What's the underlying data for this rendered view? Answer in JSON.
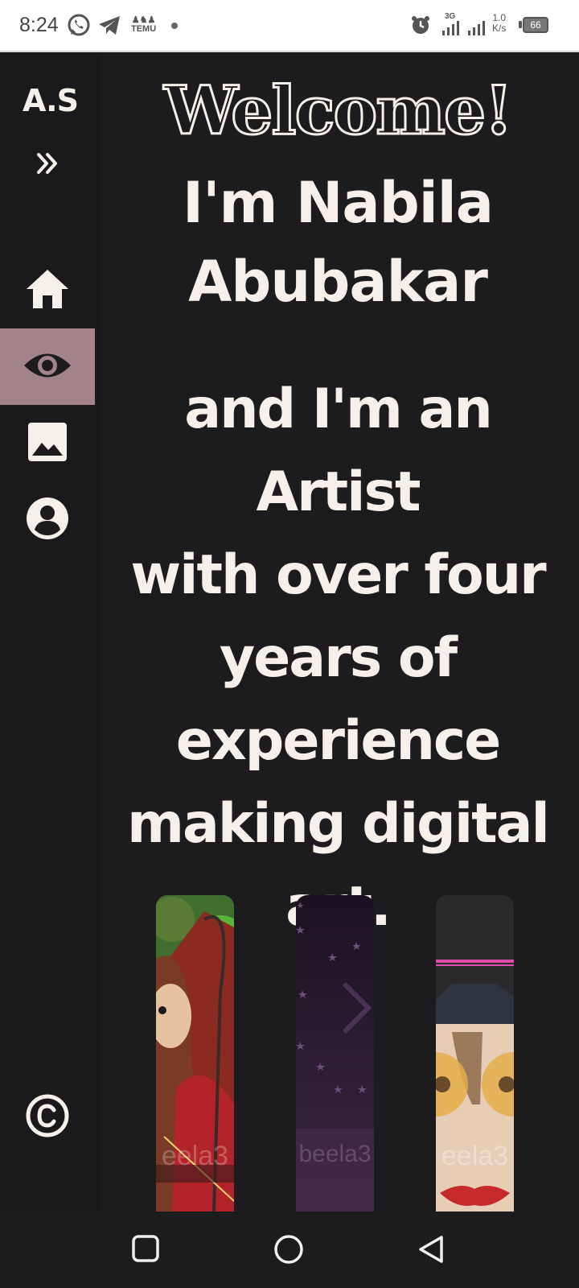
{
  "status_bar": {
    "time": "8:24",
    "temu_label": "TEMU",
    "network_label": "3G",
    "speed_value": "1.0",
    "speed_unit": "K/s",
    "battery": "66"
  },
  "sidebar": {
    "logo": "A.S",
    "items": [
      {
        "icon": "home-icon"
      },
      {
        "icon": "eye-icon",
        "active": true
      },
      {
        "icon": "image-icon"
      },
      {
        "icon": "account-icon"
      }
    ],
    "footer_icon": "copyright-icon",
    "active_color": "#a2838a"
  },
  "main": {
    "welcome": "Welcome!",
    "name_line1": "I'm Nabila",
    "name_line2": "Abubakar",
    "about_lines": [
      "and I'm an Artist",
      "with over four",
      "years of",
      "experience",
      "making digital",
      "art."
    ],
    "gallery": [
      {
        "watermark": "eela3"
      },
      {
        "watermark": "beela3"
      },
      {
        "watermark": "eela3"
      }
    ]
  },
  "nav_bar": {
    "buttons": [
      "recents-square-icon",
      "home-circle-icon",
      "back-triangle-icon"
    ]
  }
}
